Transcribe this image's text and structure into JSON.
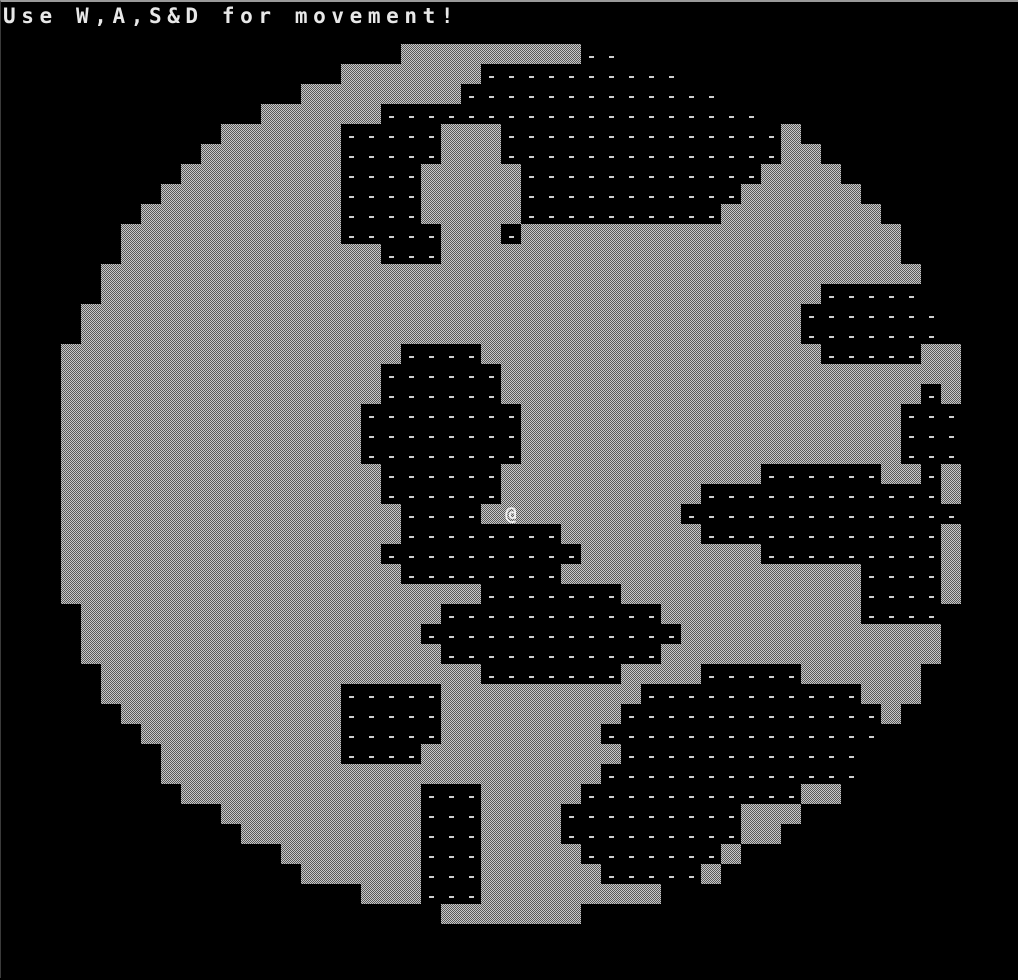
{
  "status_message": "Use W,A,S&D for movement!",
  "player_glyph": "@",
  "tiles": {
    "wall_glyph": "▒",
    "floor_glyph": "-"
  },
  "colors": {
    "background": "#000000",
    "wall": "#a0a0a0",
    "floor": "#cfcfcf",
    "text": "#e8e8e8"
  }
}
